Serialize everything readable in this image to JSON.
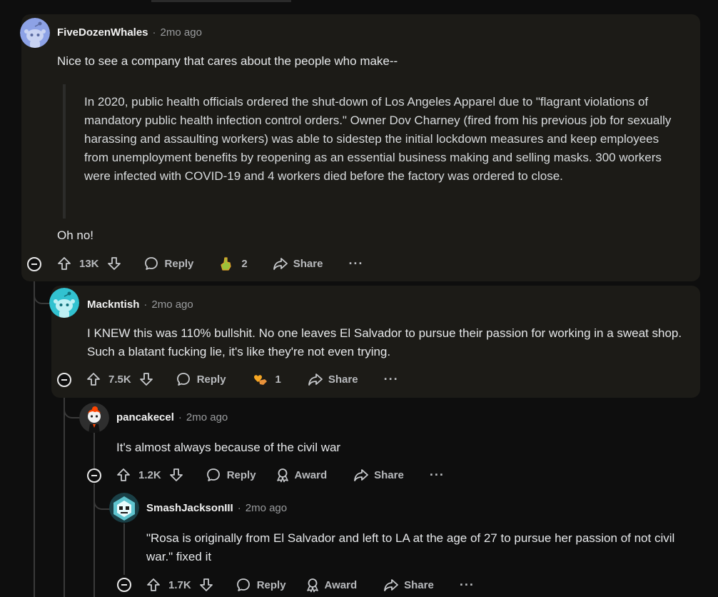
{
  "colors": {
    "background": "#0e0e0e",
    "card": "#1c1b17",
    "thread_active": "#c9a227",
    "thread_inactive": "#3a3a3a",
    "text": "#e6e8ea",
    "muted": "#9a9c9e"
  },
  "comments": [
    {
      "username": "FiveDozenWhales",
      "time": "2mo ago",
      "avatar_icon": "snoo-avatar-icon",
      "text": "Nice to see a company that cares about the people who make--",
      "quote": "In 2020, public health officials ordered the shut-down of Los Angeles Apparel due to \"flagrant violations of mandatory public health infection control orders.\" Owner Dov Charney (fired from his previous job for sexually harassing and assaulting workers) was able to sidestep the initial lockdown measures and keep employees from unemployment benefits by reopening as an essential business making and selling masks. 300 workers were infected with COVID-19 and 4 workers died before the factory was ordered to close.",
      "closing": "Oh no!",
      "votes": "13K",
      "reply_label": "Reply",
      "award_count": "2",
      "share_label": "Share",
      "more_label": "···"
    },
    {
      "username": "Mackntish",
      "time": "2mo ago",
      "avatar_icon": "snoo-avatar-icon",
      "text": "I KNEW this was 110% bullshit. No one leaves El Salvador to pursue their passion for working in a sweat shop. Such a blatant fucking lie, it's like they're not even trying.",
      "votes": "7.5K",
      "reply_label": "Reply",
      "award_count": "1",
      "share_label": "Share",
      "more_label": "···"
    },
    {
      "username": "pancakecel",
      "time": "2mo ago",
      "avatar_icon": "custom-avatar-icon",
      "text": "It's almost always because of the civil war",
      "votes": "1.2K",
      "reply_label": "Reply",
      "award_label": "Award",
      "share_label": "Share",
      "more_label": "···"
    },
    {
      "username": "SmashJacksonIII",
      "time": "2mo ago",
      "avatar_icon": "robot-avatar-icon",
      "text": "\"Rosa is originally from El Salvador and left to LA at the age of 27 to pursue her passion of not civil war.\" fixed it",
      "votes": "1.7K",
      "reply_label": "Reply",
      "award_label": "Award",
      "share_label": "Share",
      "more_label": "···"
    }
  ]
}
